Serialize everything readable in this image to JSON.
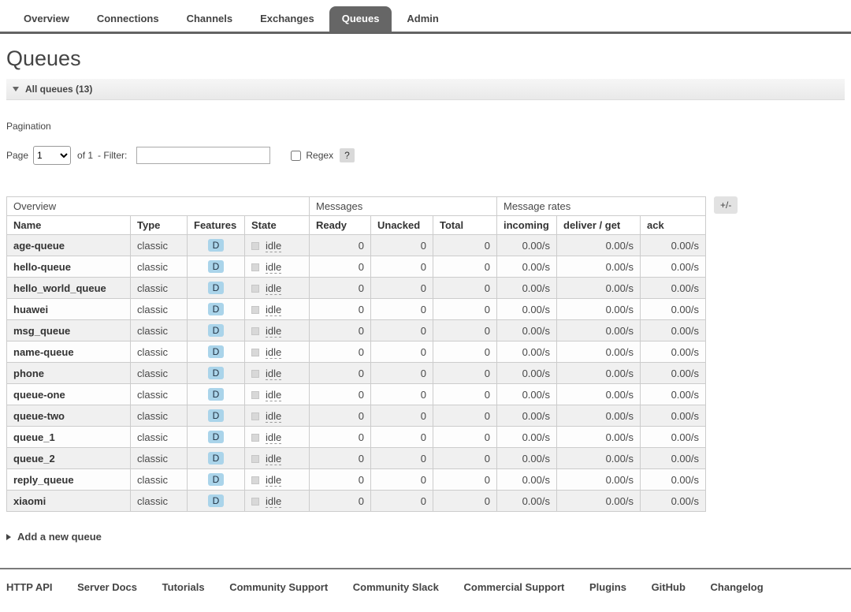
{
  "nav": {
    "tabs": [
      {
        "label": "Overview",
        "active": false
      },
      {
        "label": "Connections",
        "active": false
      },
      {
        "label": "Channels",
        "active": false
      },
      {
        "label": "Exchanges",
        "active": false
      },
      {
        "label": "Queues",
        "active": true
      },
      {
        "label": "Admin",
        "active": false
      }
    ]
  },
  "page": {
    "title": "Queues"
  },
  "queues_section": {
    "header": "All queues (13)"
  },
  "pagination": {
    "heading": "Pagination",
    "page_label": "Page",
    "selected_page": "1",
    "page_options": [
      "1"
    ],
    "of_label": "of 1",
    "filter_label": "- Filter:",
    "filter_value": "",
    "regex_label": "Regex",
    "help_label": "?"
  },
  "table": {
    "groups": [
      {
        "label": "Overview"
      },
      {
        "label": "Messages"
      },
      {
        "label": "Message rates"
      }
    ],
    "columns_toggle_label": "+/-",
    "columns": [
      "Name",
      "Type",
      "Features",
      "State",
      "Ready",
      "Unacked",
      "Total",
      "incoming",
      "deliver / get",
      "ack"
    ],
    "rows": [
      {
        "name": "age-queue",
        "type": "classic",
        "features": "D",
        "state": "idle",
        "ready": "0",
        "unacked": "0",
        "total": "0",
        "incoming": "0.00/s",
        "deliver_get": "0.00/s",
        "ack": "0.00/s"
      },
      {
        "name": "hello-queue",
        "type": "classic",
        "features": "D",
        "state": "idle",
        "ready": "0",
        "unacked": "0",
        "total": "0",
        "incoming": "0.00/s",
        "deliver_get": "0.00/s",
        "ack": "0.00/s"
      },
      {
        "name": "hello_world_queue",
        "type": "classic",
        "features": "D",
        "state": "idle",
        "ready": "0",
        "unacked": "0",
        "total": "0",
        "incoming": "0.00/s",
        "deliver_get": "0.00/s",
        "ack": "0.00/s"
      },
      {
        "name": "huawei",
        "type": "classic",
        "features": "D",
        "state": "idle",
        "ready": "0",
        "unacked": "0",
        "total": "0",
        "incoming": "0.00/s",
        "deliver_get": "0.00/s",
        "ack": "0.00/s"
      },
      {
        "name": "msg_queue",
        "type": "classic",
        "features": "D",
        "state": "idle",
        "ready": "0",
        "unacked": "0",
        "total": "0",
        "incoming": "0.00/s",
        "deliver_get": "0.00/s",
        "ack": "0.00/s"
      },
      {
        "name": "name-queue",
        "type": "classic",
        "features": "D",
        "state": "idle",
        "ready": "0",
        "unacked": "0",
        "total": "0",
        "incoming": "0.00/s",
        "deliver_get": "0.00/s",
        "ack": "0.00/s"
      },
      {
        "name": "phone",
        "type": "classic",
        "features": "D",
        "state": "idle",
        "ready": "0",
        "unacked": "0",
        "total": "0",
        "incoming": "0.00/s",
        "deliver_get": "0.00/s",
        "ack": "0.00/s"
      },
      {
        "name": "queue-one",
        "type": "classic",
        "features": "D",
        "state": "idle",
        "ready": "0",
        "unacked": "0",
        "total": "0",
        "incoming": "0.00/s",
        "deliver_get": "0.00/s",
        "ack": "0.00/s"
      },
      {
        "name": "queue-two",
        "type": "classic",
        "features": "D",
        "state": "idle",
        "ready": "0",
        "unacked": "0",
        "total": "0",
        "incoming": "0.00/s",
        "deliver_get": "0.00/s",
        "ack": "0.00/s"
      },
      {
        "name": "queue_1",
        "type": "classic",
        "features": "D",
        "state": "idle",
        "ready": "0",
        "unacked": "0",
        "total": "0",
        "incoming": "0.00/s",
        "deliver_get": "0.00/s",
        "ack": "0.00/s"
      },
      {
        "name": "queue_2",
        "type": "classic",
        "features": "D",
        "state": "idle",
        "ready": "0",
        "unacked": "0",
        "total": "0",
        "incoming": "0.00/s",
        "deliver_get": "0.00/s",
        "ack": "0.00/s"
      },
      {
        "name": "reply_queue",
        "type": "classic",
        "features": "D",
        "state": "idle",
        "ready": "0",
        "unacked": "0",
        "total": "0",
        "incoming": "0.00/s",
        "deliver_get": "0.00/s",
        "ack": "0.00/s"
      },
      {
        "name": "xiaomi",
        "type": "classic",
        "features": "D",
        "state": "idle",
        "ready": "0",
        "unacked": "0",
        "total": "0",
        "incoming": "0.00/s",
        "deliver_get": "0.00/s",
        "ack": "0.00/s"
      }
    ]
  },
  "add_queue": {
    "label": "Add a new queue"
  },
  "footer": {
    "links": [
      "HTTP API",
      "Server Docs",
      "Tutorials",
      "Community Support",
      "Community Slack",
      "Commercial Support",
      "Plugins",
      "GitHub",
      "Changelog"
    ]
  },
  "colors": {
    "active_tab_bg": "#666666",
    "durable_badge_bg": "#aad4ea",
    "row_alt_bg": "#f0f0f0"
  }
}
